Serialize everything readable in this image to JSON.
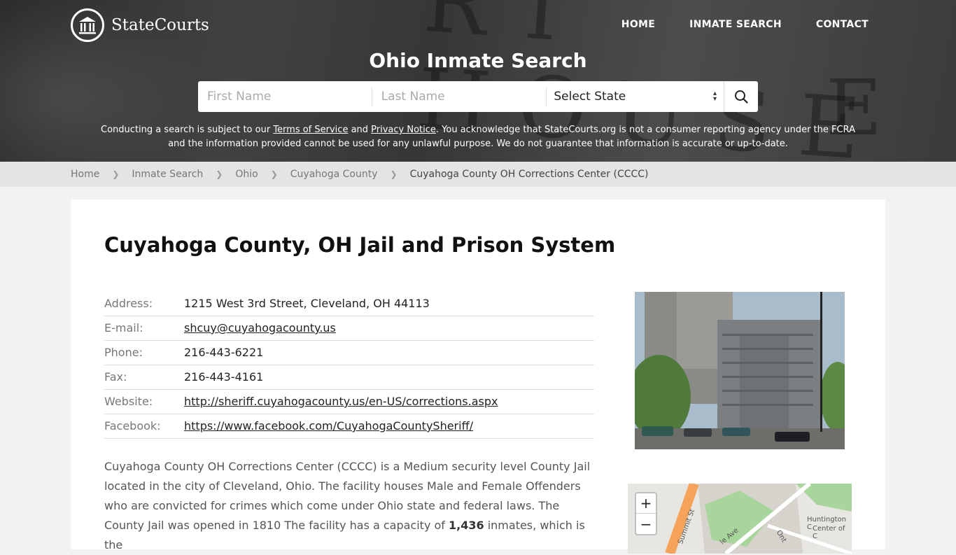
{
  "brand": {
    "name": "StateCourts"
  },
  "nav": {
    "home": "HOME",
    "inmate_search": "INMATE SEARCH",
    "contact": "CONTACT"
  },
  "hero": {
    "title": "Ohio Inmate Search"
  },
  "search": {
    "first_name_placeholder": "First Name",
    "last_name_placeholder": "Last Name",
    "state_select": "Select State"
  },
  "disclaimer": {
    "part1": "Conducting a search is subject to our ",
    "terms": "Terms of Service",
    "and": " and ",
    "privacy": "Privacy Notice",
    "part2": ". You acknowledge that StateCourts.org is not a consumer reporting agency under the FCRA and the information provided cannot be used for any unlawful purpose. We do not guarantee that information is accurate or up-to-date."
  },
  "breadcrumb": {
    "items": [
      "Home",
      "Inmate Search",
      "Ohio",
      "Cuyahoga County"
    ],
    "current": "Cuyahoga County OH Corrections Center (CCCC)"
  },
  "page": {
    "title": "Cuyahoga County, OH Jail and Prison System",
    "info": {
      "address_label": "Address:",
      "address": "1215 West 3rd Street, Cleveland, OH 44113",
      "email_label": "E-mail:",
      "email": "shcuy@cuyahogacounty.us",
      "phone_label": "Phone:",
      "phone": "216-443-6221",
      "fax_label": "Fax:",
      "fax": "216-443-4161",
      "website_label": "Website:",
      "website": "http://sheriff.cuyahogacounty.us/en-US/corrections.aspx",
      "facebook_label": "Facebook:",
      "facebook": "https://www.facebook.com/CuyahogaCountySheriff/"
    },
    "description": {
      "text1": "Cuyahoga County OH Corrections Center (CCCC) is a Medium security level County Jail located in the city of Cleveland, Ohio. The facility houses Male and Female Offenders who are convicted for crimes which come under Ohio state and federal laws. The County Jail was opened in 1810 The facility has a capacity of ",
      "capacity": "1,436",
      "text2": " inmates, which is the"
    }
  },
  "map": {
    "zoom_in": "+",
    "zoom_out": "−",
    "labels": {
      "summit": "Summit St",
      "ave": "le Ave",
      "ont": "Ont",
      "huntington1": "Huntington C",
      "huntington2": "Center of C"
    }
  }
}
